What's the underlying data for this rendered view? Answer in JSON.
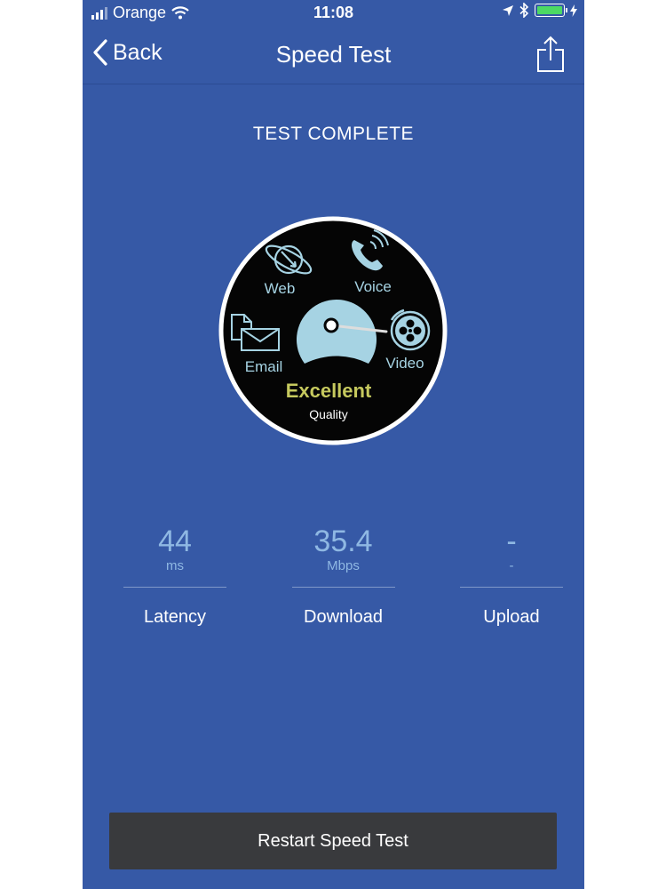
{
  "status_bar": {
    "carrier": "Orange",
    "time": "11:08"
  },
  "nav": {
    "back_label": "Back",
    "title": "Speed Test"
  },
  "test_status": "TEST COMPLETE",
  "gauge": {
    "categories": {
      "web": "Web",
      "voice": "Voice",
      "email": "Email",
      "video": "Video"
    },
    "rating": "Excellent",
    "rating_caption": "Quality"
  },
  "stats": [
    {
      "value": "44",
      "unit": "ms",
      "label": "Latency"
    },
    {
      "value": "35.4",
      "unit": "Mbps",
      "label": "Download"
    },
    {
      "value": "-",
      "unit": "-",
      "label": "Upload"
    }
  ],
  "restart_label": "Restart Speed Test",
  "colors": {
    "background": "#3659a6",
    "gauge_face": "#a6d3e3",
    "rating": "#c6c95e",
    "stat_value": "#8fb8e3",
    "button": "#393a3d",
    "battery": "#4cd964"
  }
}
